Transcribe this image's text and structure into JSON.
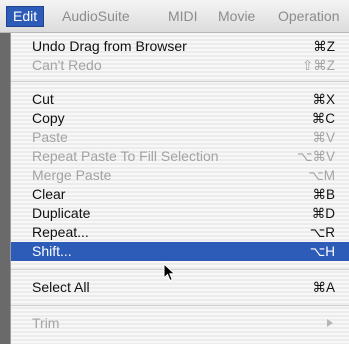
{
  "menubar": {
    "items": [
      {
        "label": "Edit"
      },
      {
        "label": "AudioSuite"
      },
      {
        "label": "MIDI"
      },
      {
        "label": "Movie"
      },
      {
        "label": "Operation"
      }
    ]
  },
  "edit_menu": {
    "items": [
      {
        "label": "Undo Drag from Browser",
        "shortcut": "⌘Z",
        "enabled": true
      },
      {
        "label": "Can't Redo",
        "shortcut": "⇧⌘Z",
        "enabled": false
      },
      {
        "label": "Cut",
        "shortcut": "⌘X",
        "enabled": true
      },
      {
        "label": "Copy",
        "shortcut": "⌘C",
        "enabled": true
      },
      {
        "label": "Paste",
        "shortcut": "⌘V",
        "enabled": false
      },
      {
        "label": "Repeat Paste To Fill Selection",
        "shortcut": "⌥⌘V",
        "enabled": false
      },
      {
        "label": "Merge Paste",
        "shortcut": "⌥M",
        "enabled": false
      },
      {
        "label": "Clear",
        "shortcut": "⌘B",
        "enabled": true
      },
      {
        "label": "Duplicate",
        "shortcut": "⌘D",
        "enabled": true
      },
      {
        "label": "Repeat...",
        "shortcut": "⌥R",
        "enabled": true
      },
      {
        "label": "Shift...",
        "shortcut": "⌥H",
        "enabled": true,
        "highlighted": true
      },
      {
        "label": "Select All",
        "shortcut": "⌘A",
        "enabled": true
      },
      {
        "label": "Trim",
        "shortcut": "",
        "enabled": false,
        "submenu": true
      }
    ]
  },
  "colors": {
    "highlight": "#2c5bb8",
    "enabled_text": "#111111",
    "disabled_text": "#a3a3a3"
  }
}
